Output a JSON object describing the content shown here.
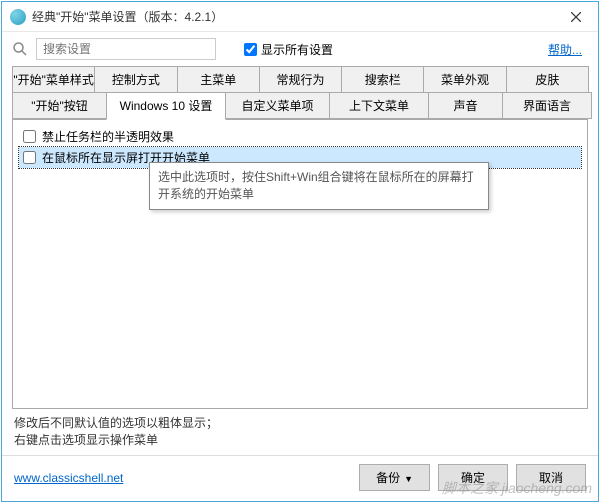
{
  "window": {
    "title": "经典\"开始\"菜单设置（版本：4.2.1）"
  },
  "search": {
    "placeholder": "搜索设置"
  },
  "show_all": {
    "label": "显示所有设置"
  },
  "help": {
    "label": "帮助..."
  },
  "tabs_row1": [
    "\"开始\"菜单样式",
    "控制方式",
    "主菜单",
    "常规行为",
    "搜索栏",
    "菜单外观",
    "皮肤"
  ],
  "tabs_row2": [
    "\"开始\"按钮",
    "Windows 10 设置",
    "自定义菜单项",
    "上下文菜单",
    "声音",
    "界面语言"
  ],
  "options": [
    {
      "label": "禁止任务栏的半透明效果",
      "checked": false
    },
    {
      "label": "在鼠标所在显示屏打开开始菜单",
      "checked": false
    }
  ],
  "tooltip": "选中此选项时，按住Shift+Win组合键将在鼠标所在的屏幕打开系统的开始菜单",
  "footer_note_1": "修改后不同默认值的选项以粗体显示；",
  "footer_note_2": "右键点击选项显示操作菜单",
  "bottom": {
    "link": "www.classicshell.net",
    "backup": "备份",
    "ok": "确定",
    "cancel": "取消"
  },
  "watermark": "脚本之家 jiaocheng.com"
}
